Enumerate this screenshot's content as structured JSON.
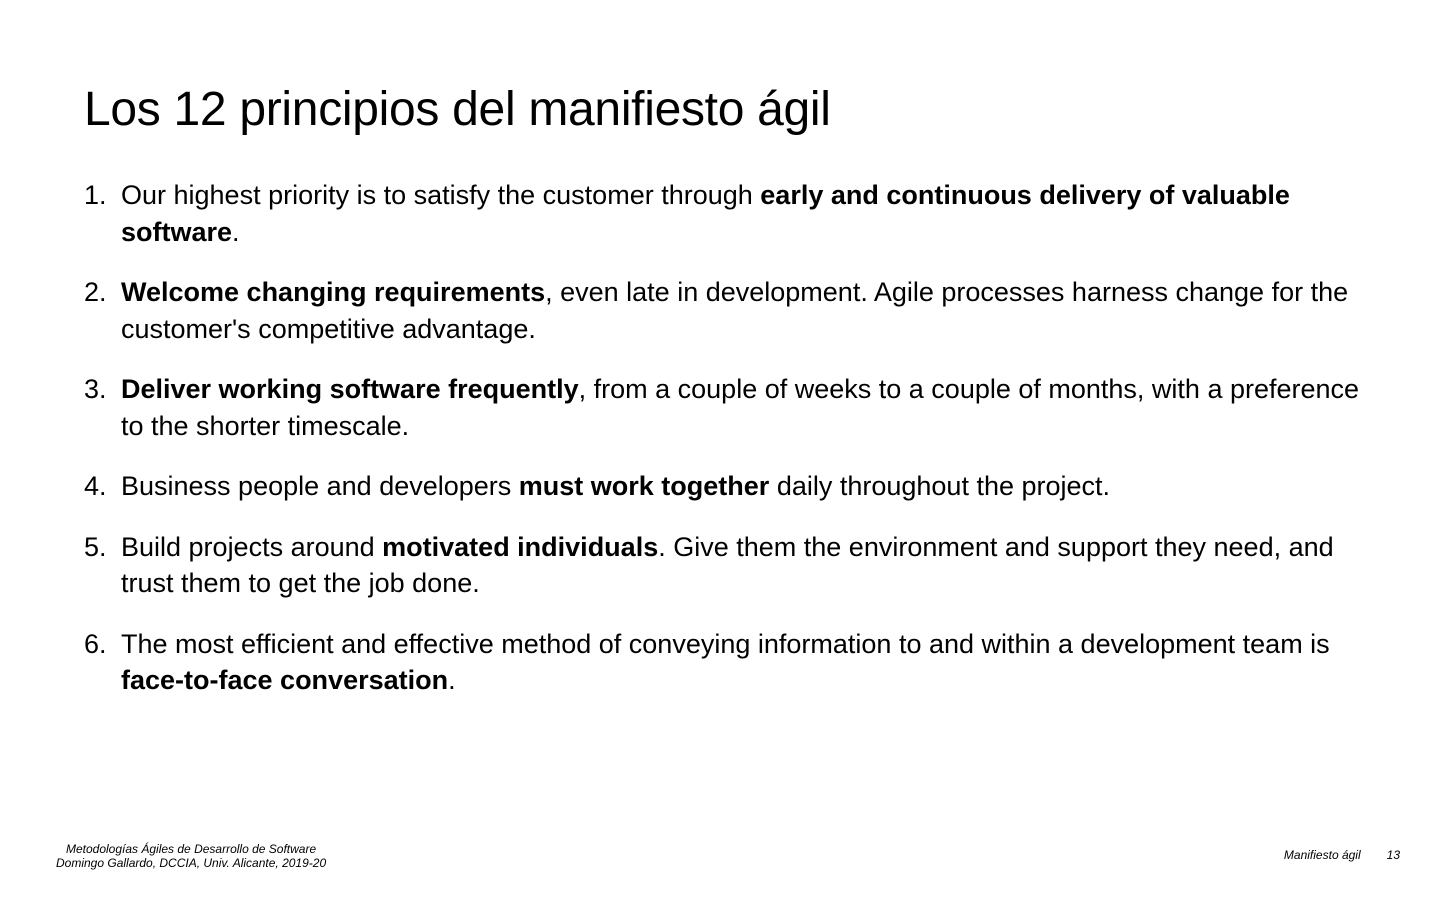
{
  "slide": {
    "title": "Los 12 principios del manifiesto ágil"
  },
  "principles": [
    {
      "number": "1.",
      "before": "Our highest priority is to satisfy the customer through ",
      "bold": "early and continuous delivery of valuable software",
      "after": "."
    },
    {
      "number": "2.",
      "before": "",
      "bold": "Welcome changing requirements",
      "after": ", even late in development. Agile processes harness change for the customer's competitive advantage."
    },
    {
      "number": "3.",
      "before": "",
      "bold": "Deliver working software frequently",
      "after": ", from a couple of weeks to a couple of months, with a preference to the shorter timescale."
    },
    {
      "number": "4.",
      "before": "Business people and developers ",
      "bold": "must work together",
      "after": " daily throughout the project."
    },
    {
      "number": "5.",
      "before": "Build projects around ",
      "bold": "motivated individuals",
      "after": ". Give them the environment and support they need, and trust them to get the job done."
    },
    {
      "number": "6.",
      "before": "The most efficient and effective method of conveying information to and within a development team is ",
      "bold": "face-to-face conversation",
      "after": "."
    }
  ],
  "footer": {
    "course": "Metodologías Ágiles de Desarrollo de Software",
    "author": "Domingo Gallardo, DCCIA, Univ. Alicante, 2019-20",
    "section": "Manifiesto ágil",
    "page": "13"
  }
}
